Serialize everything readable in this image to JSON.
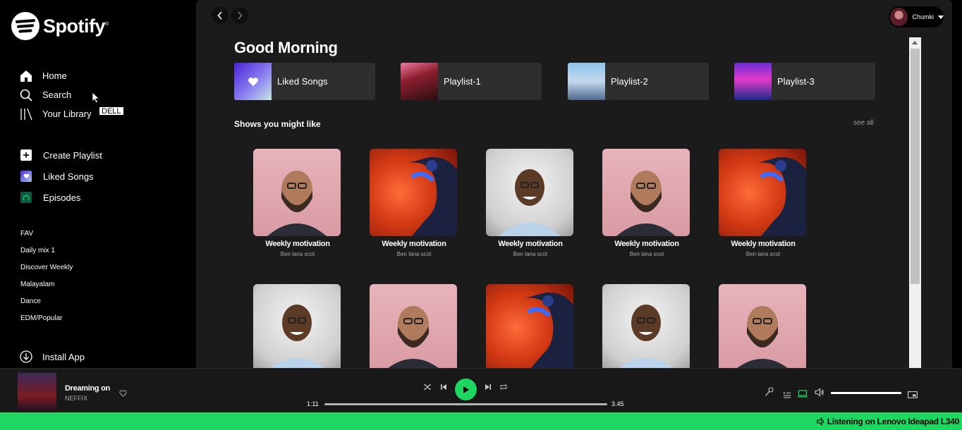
{
  "app": {
    "brand": "Spotify",
    "trademark": "®"
  },
  "sidebar": {
    "nav": [
      {
        "label": "Home",
        "icon": "home-icon"
      },
      {
        "label": "Search",
        "icon": "search-icon"
      },
      {
        "label": "Your Library",
        "icon": "library-icon"
      }
    ],
    "tooltip": "DELL",
    "actions": [
      {
        "label": "Create Playlist",
        "icon": "plus-icon"
      },
      {
        "label": "Liked Songs",
        "icon": "heart-icon"
      },
      {
        "label": "Episodes",
        "icon": "podcast-icon"
      }
    ],
    "playlists": [
      "FAV",
      "Daily mix 1",
      "Discover Weekly",
      "Malayalam",
      "Dance",
      "EDM/Popular"
    ],
    "install_label": "Install App"
  },
  "header": {
    "user_name": "Chumki"
  },
  "main": {
    "greeting": "Good Morning",
    "quick": [
      {
        "label": "Liked Songs"
      },
      {
        "label": "Playlist-1"
      },
      {
        "label": "Playlist-2"
      },
      {
        "label": "Playlist-3"
      }
    ],
    "section_title": "Shows you might like",
    "see_all": "see all",
    "cards_row1": [
      {
        "title": "Weekly motivation",
        "subtitle": "Ben lana scot",
        "art": "pink"
      },
      {
        "title": "Weekly motivation",
        "subtitle": "Ben lana scot",
        "art": "red"
      },
      {
        "title": "Weekly motivation",
        "subtitle": "Ben lana scot",
        "art": "white"
      },
      {
        "title": "Weekly motivation",
        "subtitle": "Ben lana scot",
        "art": "pink"
      },
      {
        "title": "Weekly motivation",
        "subtitle": "Ben lana scot",
        "art": "red"
      }
    ],
    "cards_row2": [
      {
        "art": "white"
      },
      {
        "art": "pink"
      },
      {
        "art": "red"
      },
      {
        "art": "white"
      },
      {
        "art": "pink"
      }
    ]
  },
  "player": {
    "track_title": "Dreaming on",
    "artist": "NEFFIX",
    "elapsed": "1:11",
    "duration": "3.45",
    "progress_fraction": 0.0,
    "volume_fraction": 1.0
  },
  "banner": {
    "text": "Listening on Lenovo Ideapad L340"
  },
  "colors": {
    "accent": "#1ed760",
    "background": "#000000",
    "panel": "#1b1b1b"
  }
}
